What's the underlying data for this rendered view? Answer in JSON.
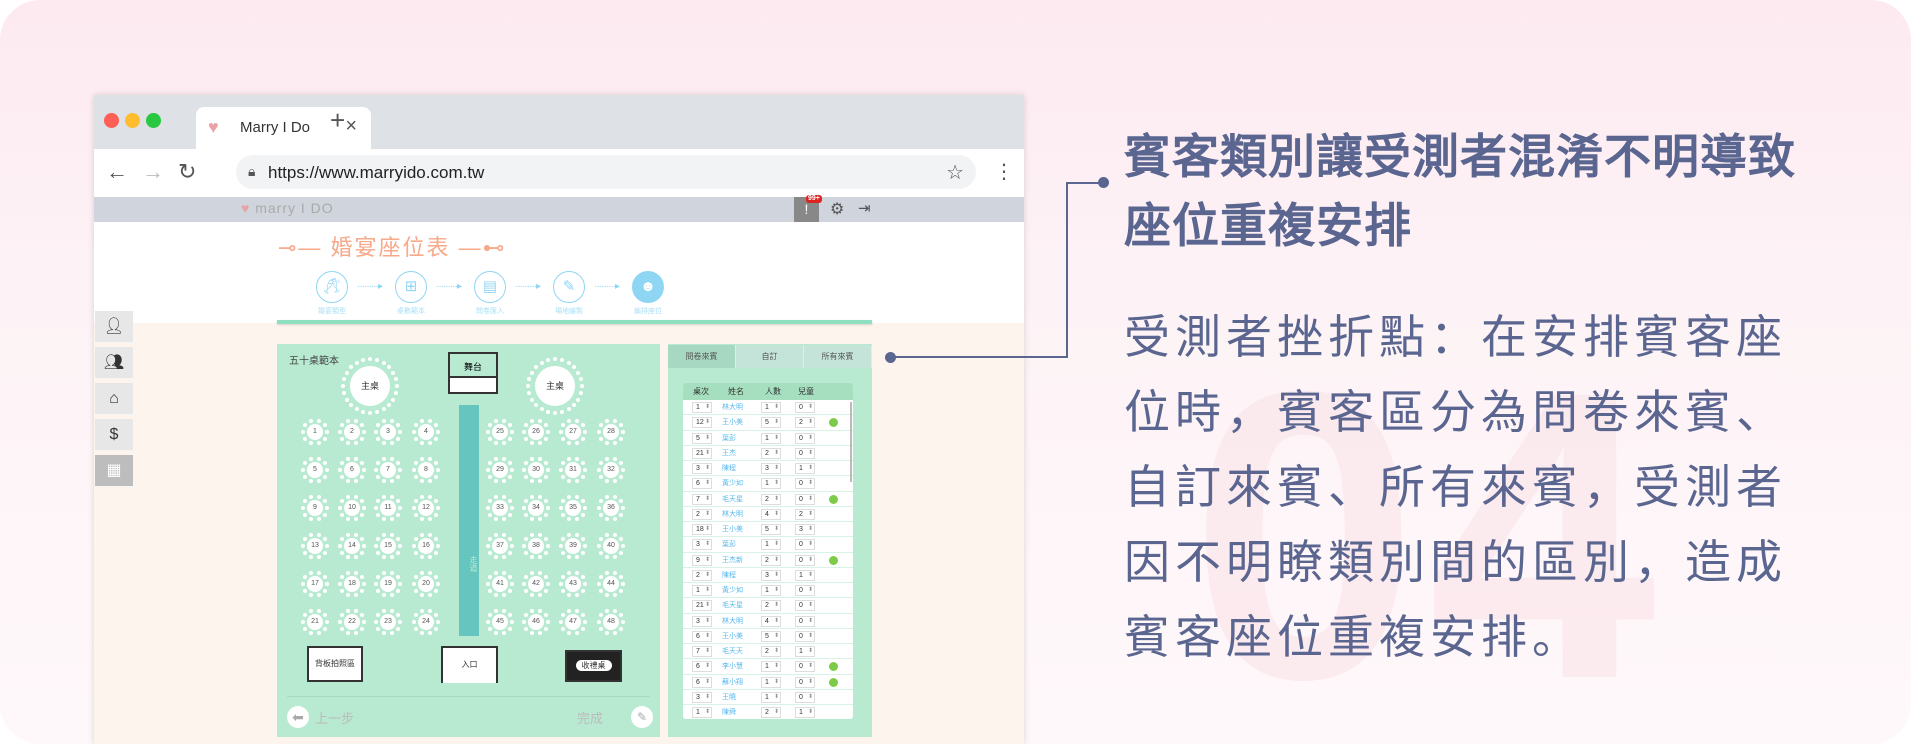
{
  "browser": {
    "tab_title": "Marry I Do",
    "url": "https://www.marryido.com.tw",
    "icons": [
      "back-arrow",
      "forward-arrow",
      "reload",
      "lock",
      "star",
      "kebab-menu",
      "close",
      "new-tab"
    ]
  },
  "app": {
    "logo_text": "marry I DO",
    "notification_badge": "99+",
    "page_title": "婚宴座位表",
    "steps": [
      {
        "label": "婚宴類型",
        "icon": "toast-icon"
      },
      {
        "label": "桌數範本",
        "icon": "table-icon"
      },
      {
        "label": "問卷匯入",
        "icon": "document-icon"
      },
      {
        "label": "場地繪製",
        "icon": "pen-icon"
      },
      {
        "label": "編排座位",
        "icon": "people-icon",
        "active": true
      }
    ],
    "sidebar": [
      "person-icon",
      "group-icon",
      "store-icon",
      "money-bag-icon",
      "clipboard-icon"
    ]
  },
  "plan": {
    "template_name": "五十桌範本",
    "main_table": "主桌",
    "stage": "舞台",
    "aisle": "走道",
    "photo_zone": "背板拍照區",
    "entrance": "入口",
    "gift_table": "收禮桌",
    "tables": [
      1,
      2,
      3,
      4,
      5,
      6,
      7,
      8,
      9,
      10,
      11,
      12,
      13,
      14,
      15,
      16,
      17,
      18,
      19,
      20,
      21,
      22,
      23,
      24,
      25,
      26,
      27,
      28,
      29,
      30,
      31,
      32,
      33,
      34,
      35,
      36,
      37,
      38,
      39,
      40,
      41,
      42,
      43,
      44,
      45,
      46,
      47,
      48
    ],
    "back_label": "上一步",
    "done_label": "完成"
  },
  "guests": {
    "tabs": [
      "問卷來賓",
      "自訂",
      "所有來賓"
    ],
    "active_tab": 0,
    "headers": [
      "桌次",
      "姓名",
      "人數",
      "兒童"
    ],
    "rows": [
      {
        "table": "1",
        "name": "林大明",
        "count": "1",
        "kids": "0",
        "badge": false
      },
      {
        "table": "12",
        "name": "王小美",
        "count": "5",
        "kids": "2",
        "badge": true
      },
      {
        "table": "5",
        "name": "葉彭",
        "count": "1",
        "kids": "0",
        "badge": false
      },
      {
        "table": "21",
        "name": "王杰",
        "count": "2",
        "kids": "0",
        "badge": false
      },
      {
        "table": "3",
        "name": "陳程",
        "count": "3",
        "kids": "1",
        "badge": false
      },
      {
        "table": "6",
        "name": "黃少如",
        "count": "1",
        "kids": "0",
        "badge": false
      },
      {
        "table": "7",
        "name": "毛天星",
        "count": "2",
        "kids": "0",
        "badge": true
      },
      {
        "table": "2",
        "name": "林大明",
        "count": "4",
        "kids": "2",
        "badge": false
      },
      {
        "table": "18",
        "name": "王小美",
        "count": "5",
        "kids": "3",
        "badge": false
      },
      {
        "table": "3",
        "name": "葉彭",
        "count": "1",
        "kids": "0",
        "badge": false
      },
      {
        "table": "9",
        "name": "王杰新",
        "count": "2",
        "kids": "0",
        "badge": true
      },
      {
        "table": "2",
        "name": "陳程",
        "count": "3",
        "kids": "1",
        "badge": false
      },
      {
        "table": "1",
        "name": "黃少如",
        "count": "1",
        "kids": "0",
        "badge": false
      },
      {
        "table": "21",
        "name": "毛天星",
        "count": "2",
        "kids": "0",
        "badge": false
      },
      {
        "table": "3",
        "name": "林大明",
        "count": "4",
        "kids": "0",
        "badge": false
      },
      {
        "table": "6",
        "name": "王小美",
        "count": "5",
        "kids": "0",
        "badge": false
      },
      {
        "table": "7",
        "name": "毛天天",
        "count": "2",
        "kids": "1",
        "badge": false
      },
      {
        "table": "6",
        "name": "李小慧",
        "count": "1",
        "kids": "0",
        "badge": true
      },
      {
        "table": "6",
        "name": "蘇小翔",
        "count": "1",
        "kids": "0",
        "badge": true
      },
      {
        "table": "3",
        "name": "王曉",
        "count": "1",
        "kids": "0",
        "badge": false
      },
      {
        "table": "1",
        "name": "陳舜",
        "count": "2",
        "kids": "1",
        "badge": false
      }
    ]
  },
  "annotation": {
    "title": "賓客類別讓受測者混淆不明導致座位重複安排",
    "body": "受測者挫折點：在安排賓客座位時，賓客區分為問卷來賓、自訂來賓、所有來賓，受測者因不明瞭類別間的區別，造成賓客座位重複安排。",
    "number": "04"
  },
  "colors": {
    "accent": "#5a6590",
    "mint": "#b8ead2",
    "sky": "#8fd6f4",
    "salmon": "#f7a98a"
  }
}
